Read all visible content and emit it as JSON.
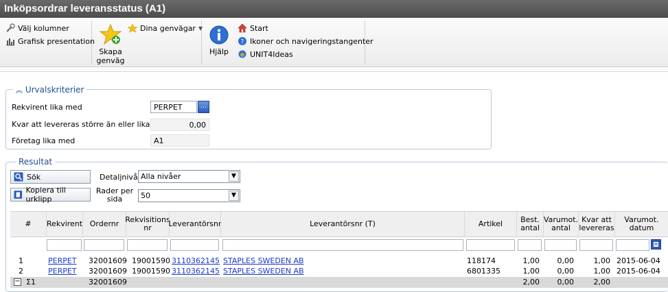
{
  "window": {
    "title": "Inköpsordrar leveransstatus (A1)"
  },
  "toolbar": {
    "choose_columns": "Välj kolumner",
    "graphic": "Grafisk presentation",
    "create_shortcut": "Skapa genväg",
    "shortcuts": "Dina genvägar",
    "help": "Hjälp",
    "start": "Start",
    "icons_nav": "Ikoner och navigeringstangenter",
    "ideas": "UNIT4Ideas"
  },
  "criteria": {
    "legend": "Urvalskriterier",
    "requester_label": "Rekvirent lika med",
    "requester_value": "PERPET",
    "remaining_label": "Kvar att levereras större än eller lika med",
    "remaining_value": "0,00",
    "company_label": "Företag lika med",
    "company_value": "A1"
  },
  "results": {
    "legend": "Resultat",
    "search_button": "Sök",
    "copy_button": "Kopiera till urklipp",
    "detail_label": "Detaljnivå",
    "detail_value": "Alla nivåer",
    "rows_label": "Rader per sida",
    "rows_value": "50"
  },
  "table": {
    "headers": [
      "#",
      "Rekvirent",
      "Ordernr",
      "Rekvisitions nr",
      "Leverantörsnr",
      "Leverantörsnr (T)",
      "Artikel",
      "Best. antal",
      "Varumot. antal",
      "Kvar att levereras",
      "Varumot. datum"
    ],
    "rows": [
      [
        "1",
        "PERPET",
        "32001609",
        "19001590",
        "3110362145",
        "STAPLES SWEDEN AB",
        "118174",
        "1,00",
        "0,00",
        "1,00",
        "2015-06-04"
      ],
      [
        "2",
        "PERPET",
        "32001609",
        "19001590",
        "3110362145",
        "STAPLES SWEDEN AB",
        "6801335",
        "1,00",
        "0,00",
        "1,00",
        "2015-06-04"
      ]
    ],
    "sum": {
      "label": "Σ1",
      "order": "32001609",
      "ordered": "2,00",
      "received": "0,00",
      "remaining": "2,00"
    }
  }
}
